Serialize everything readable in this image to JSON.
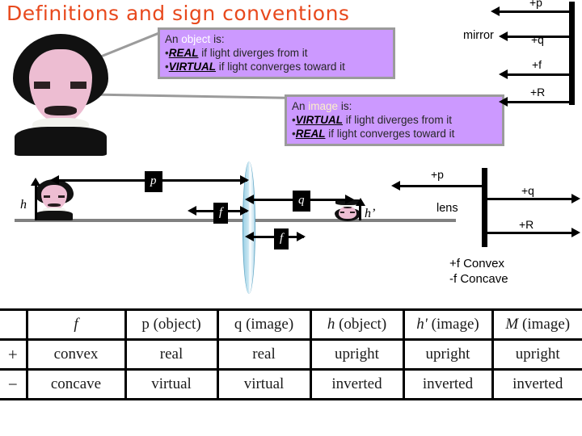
{
  "title": "Definitions and sign conventions",
  "callouts": [
    {
      "lead": "An",
      "highlight": "object",
      "lead_tail": "is:",
      "bullets": [
        {
          "bullet": "•",
          "term": "REAL",
          "rest": "if light diverges from it"
        },
        {
          "bullet": "•",
          "term": "VIRTUAL",
          "rest": "if light converges toward it"
        }
      ]
    },
    {
      "lead": "An",
      "highlight": "image",
      "lead_tail": "is:",
      "bullets": [
        {
          "bullet": "•",
          "term": "VIRTUAL",
          "rest": "if light diverges from it"
        },
        {
          "bullet": "•",
          "term": "REAL",
          "rest": "if light converges toward it"
        }
      ]
    }
  ],
  "mirror_section": {
    "label": "mirror",
    "arrows": [
      {
        "label": "+p",
        "direction": "left"
      },
      {
        "label": "+q",
        "direction": "left"
      },
      {
        "label": "+f",
        "direction": "left"
      },
      {
        "label": "+R",
        "direction": "left"
      }
    ]
  },
  "lens_section": {
    "label": "lens",
    "arrows": [
      {
        "label": "+p",
        "direction": "left"
      },
      {
        "label": "+q",
        "direction": "right"
      },
      {
        "label": "+R",
        "direction": "right"
      }
    ],
    "focal_notes": [
      "+f Convex",
      "-f Concave"
    ]
  },
  "diagram": {
    "object_height_label": "h",
    "image_height_label": "h’",
    "object_distance_label": "p",
    "image_distance_label": "q",
    "focal_left_label": "f",
    "focal_right_label": "f"
  },
  "table": {
    "headers": [
      "",
      "f",
      "p (object)",
      "q (image)",
      "h (object)",
      "h' (image)",
      "M (image)"
    ],
    "header_vars": [
      "",
      "f",
      "p",
      "q",
      "h",
      "h'",
      "M"
    ],
    "header_tails": [
      "",
      "",
      " (object)",
      " (image)",
      " (object)",
      " (image)",
      " (image)"
    ],
    "rows": [
      {
        "sign": "+",
        "cells": [
          "convex",
          "real",
          "real",
          "upright",
          "upright",
          "upright"
        ]
      },
      {
        "sign": "−",
        "cells": [
          "concave",
          "virtual",
          "virtual",
          "inverted",
          "inverted",
          "inverted"
        ]
      }
    ]
  },
  "colors": {
    "title": "#e8491d",
    "callout_fill": "#cc99ff",
    "callout_border": "#9b9b9b",
    "axis": "#808080",
    "lens": "#9fd2e6",
    "ink": "#000000"
  }
}
